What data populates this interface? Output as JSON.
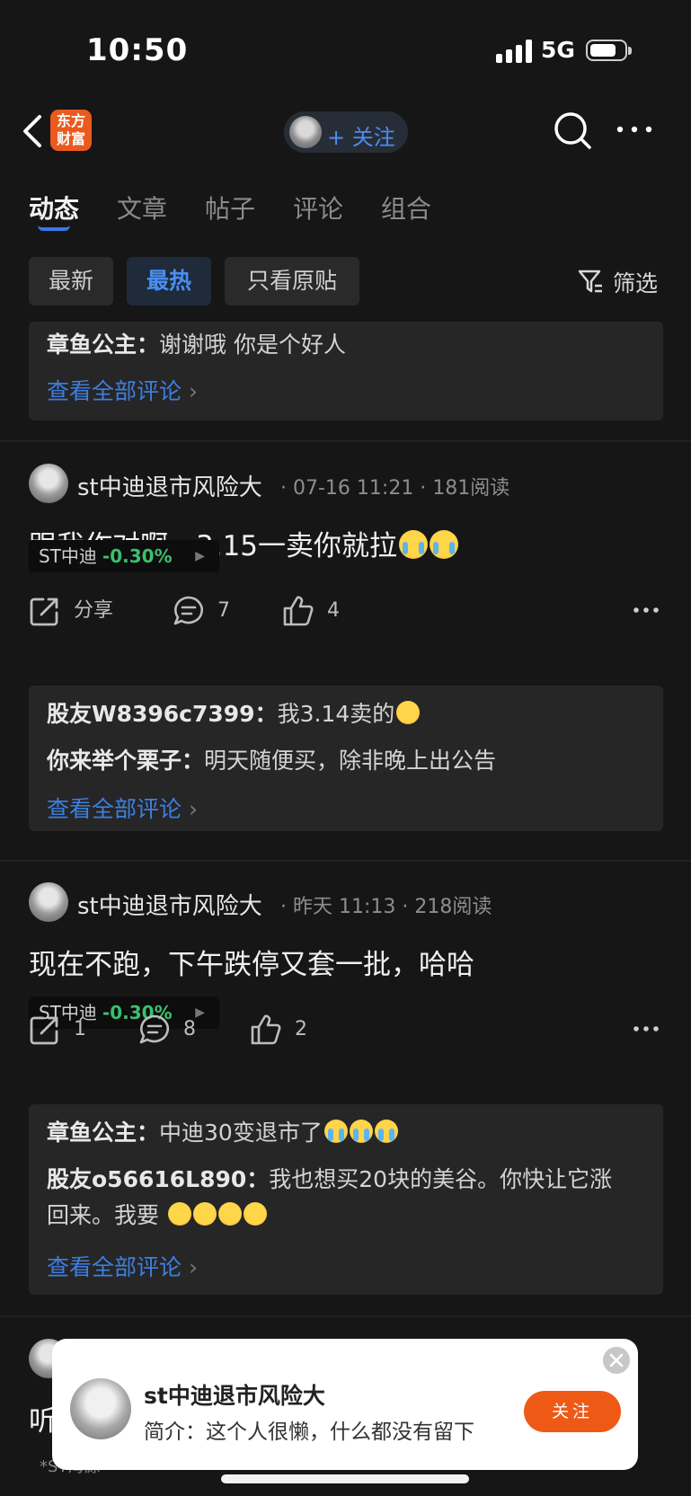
{
  "status_bar": {
    "time": "10:50",
    "network": "5G"
  },
  "nav": {
    "logo_text_line1": "东方",
    "logo_text_line2": "财富",
    "follow_label": "+ 关注"
  },
  "tabs": [
    {
      "label": "动态",
      "active": true
    },
    {
      "label": "文章",
      "active": false
    },
    {
      "label": "帖子",
      "active": false
    },
    {
      "label": "评论",
      "active": false
    },
    {
      "label": "组合",
      "active": false
    }
  ],
  "filters": {
    "options": [
      "最新",
      "最热",
      "只看原贴"
    ],
    "selected": "最热",
    "filter_label": "筛选"
  },
  "top_comment_box": {
    "comments": [
      {
        "user": "章鱼公主：",
        "text": "谢谢哦 你是个好人"
      }
    ],
    "view_all": "查看全部评论"
  },
  "posts": [
    {
      "author": "st中迪退市风险大",
      "time": "07-16 11:21",
      "reads": "181阅读",
      "text": "跟我作对啊，3.15一卖你就拉",
      "emojis": [
        "crying-emoji",
        "crying-emoji"
      ],
      "stock": {
        "name": "ST中迪",
        "change": "-0.30%"
      },
      "actions": {
        "share": "分享",
        "comments": "7",
        "likes": "4"
      },
      "comment_box": {
        "comments": [
          {
            "user": "股友W8396c7399：",
            "text": "我3.14卖的"
          },
          {
            "user": "你来举个栗子：",
            "text": "明天随便买，除非晚上出公告"
          }
        ],
        "view_all": "查看全部评论"
      }
    },
    {
      "author": "st中迪退市风险大",
      "time": "昨天 11:13",
      "reads": "218阅读",
      "text": "现在不跑，下午跌停又套一批，哈哈",
      "stock": {
        "name": "ST中迪",
        "change": "-0.30%"
      },
      "actions": {
        "share": "1",
        "comments": "8",
        "likes": "2"
      },
      "comment_box": {
        "comments": [
          {
            "user": "章鱼公主：",
            "text": "中迪30变退市了"
          },
          {
            "user": "股友o56616L890：",
            "text": "我也想买20块的美谷。你快让它涨"
          },
          {
            "user": "",
            "text": "回来。我要"
          }
        ],
        "view_all": "查看全部评论"
      }
    }
  ],
  "peek_post": {
    "text": "听",
    "stock": "*ST海源"
  },
  "popup": {
    "name": "st中迪退市风险大",
    "bio": "简介：这个人很懒，什么都没有留下",
    "follow_label": "关注"
  },
  "colors": {
    "accent_blue": "#3d7fe0",
    "brand_orange": "#ea5a1e",
    "down_green": "#3bbf6f",
    "background": "#161616"
  }
}
